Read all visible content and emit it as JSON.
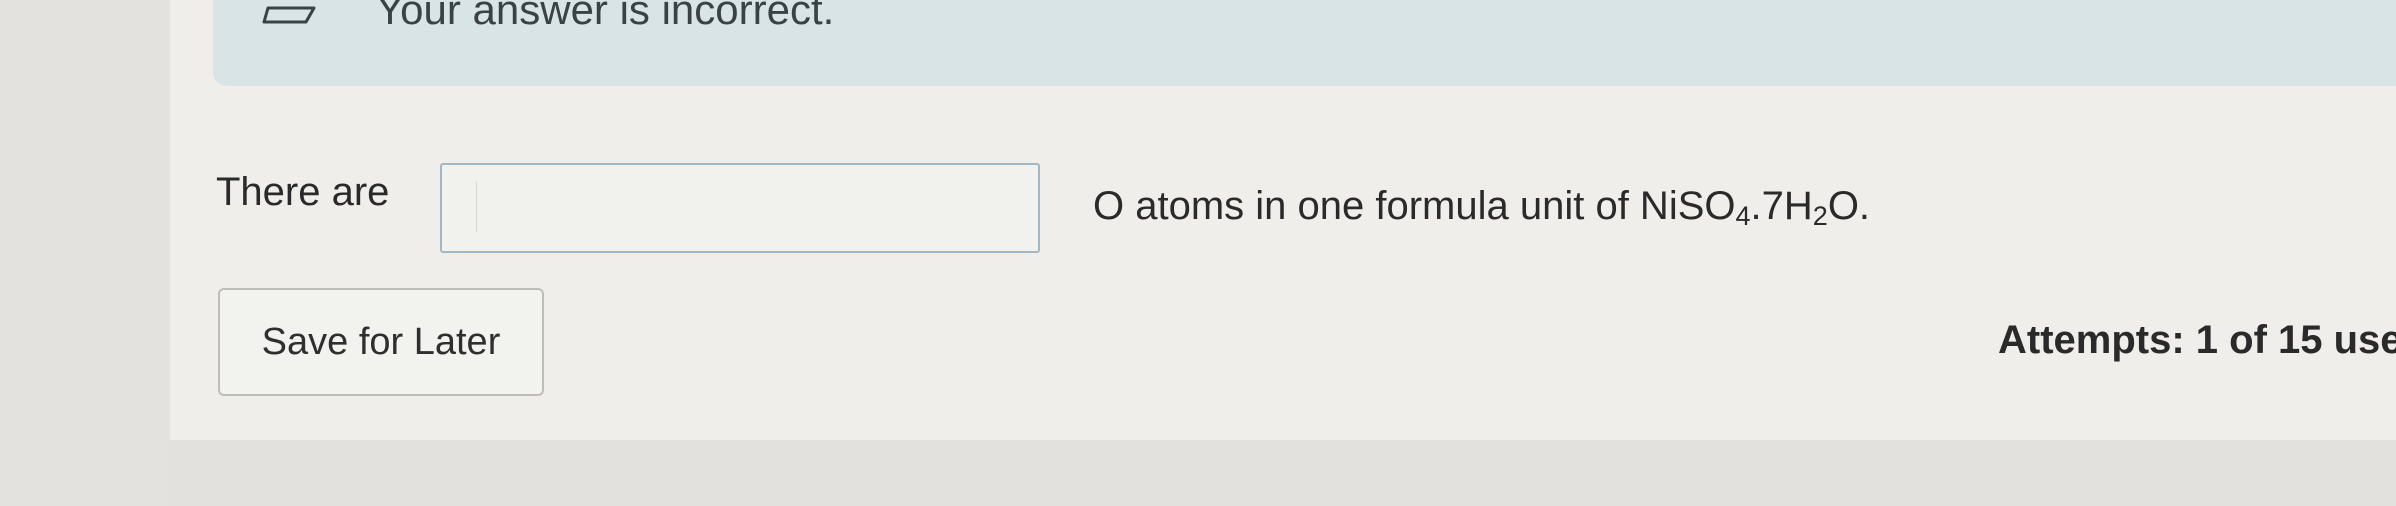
{
  "feedback": {
    "message": "Your answer is incorrect."
  },
  "question": {
    "prefix": "There are",
    "suffix_text": "O atoms in one formula unit of NiSO",
    "subscript_1": "4",
    "middle": ".7H",
    "subscript_2": "2",
    "end": "O."
  },
  "answer_input": {
    "value": "",
    "placeholder": ""
  },
  "actions": {
    "save_label": "Save for Later"
  },
  "attempts": {
    "text": "Attempts: 1 of 15 use"
  },
  "colors": {
    "banner": "#d9e4e6",
    "input_border": "#a3b8c6",
    "page": "#efeeea"
  }
}
